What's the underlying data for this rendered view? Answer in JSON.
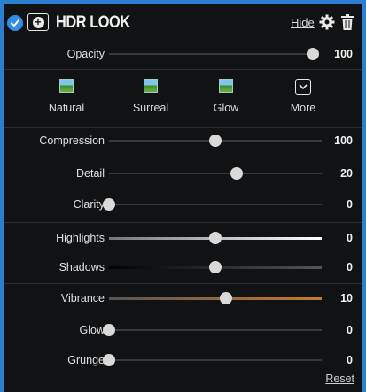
{
  "header": {
    "title": "HDR LOOK",
    "hide_label": "Hide"
  },
  "opacity": {
    "label": "Opacity",
    "value": "100",
    "level": 1.0
  },
  "presets": [
    {
      "label": "Natural",
      "icon": "landscape-thumbnail-icon"
    },
    {
      "label": "Surreal",
      "icon": "landscape-thumbnail-icon"
    },
    {
      "label": "Glow",
      "icon": "landscape-thumbnail-icon"
    },
    {
      "label": "More",
      "icon": "chevron-down-box-icon"
    }
  ],
  "sliders": [
    {
      "label": "Compression",
      "value": "100",
      "level": 0.5
    },
    {
      "label": "Detail",
      "value": "20",
      "level": 0.6
    },
    {
      "label": "Clarity",
      "value": "0",
      "level": 0.0
    },
    {
      "label": "Highlights",
      "value": "0",
      "level": 0.5
    },
    {
      "label": "Shadows",
      "value": "0",
      "level": 0.5
    },
    {
      "label": "Vibrance",
      "value": "10",
      "level": 0.55
    },
    {
      "label": "Glow",
      "value": "0",
      "level": 0.0
    },
    {
      "label": "Grunge",
      "value": "0",
      "level": 0.0
    }
  ],
  "reset_label": "Reset",
  "colors": {
    "accent": "#2f8ee6",
    "vibrance": "#c97a2b",
    "highlights": "#ffffff"
  }
}
